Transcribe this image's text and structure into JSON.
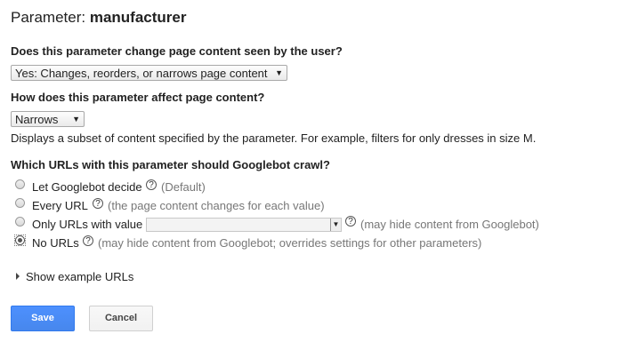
{
  "header": {
    "title_prefix": "Parameter:",
    "parameter_name": "manufacturer"
  },
  "question_change": {
    "label": "Does this parameter change page content seen by the user?",
    "selected": "Yes: Changes, reorders, or narrows page content"
  },
  "question_affect": {
    "label": "How does this parameter affect page content?",
    "selected": "Narrows",
    "description": "Displays a subset of content specified by the parameter. For example, filters for only dresses in size M."
  },
  "crawl": {
    "label": "Which URLs with this parameter should Googlebot crawl?",
    "options": [
      {
        "label": "Let Googlebot decide",
        "hint": "(Default)",
        "checked": false
      },
      {
        "label": "Every URL",
        "hint": "(the page content changes for each value)",
        "checked": false
      },
      {
        "label": "Only URLs with value",
        "hint": "(may hide content from Googlebot)",
        "checked": false,
        "value": ""
      },
      {
        "label": "No URLs",
        "hint": "(may hide content from Googlebot; overrides settings for other parameters)",
        "checked": true
      }
    ],
    "help_glyph": "?"
  },
  "examples": {
    "label": "Show example URLs"
  },
  "actions": {
    "save": "Save",
    "cancel": "Cancel"
  }
}
